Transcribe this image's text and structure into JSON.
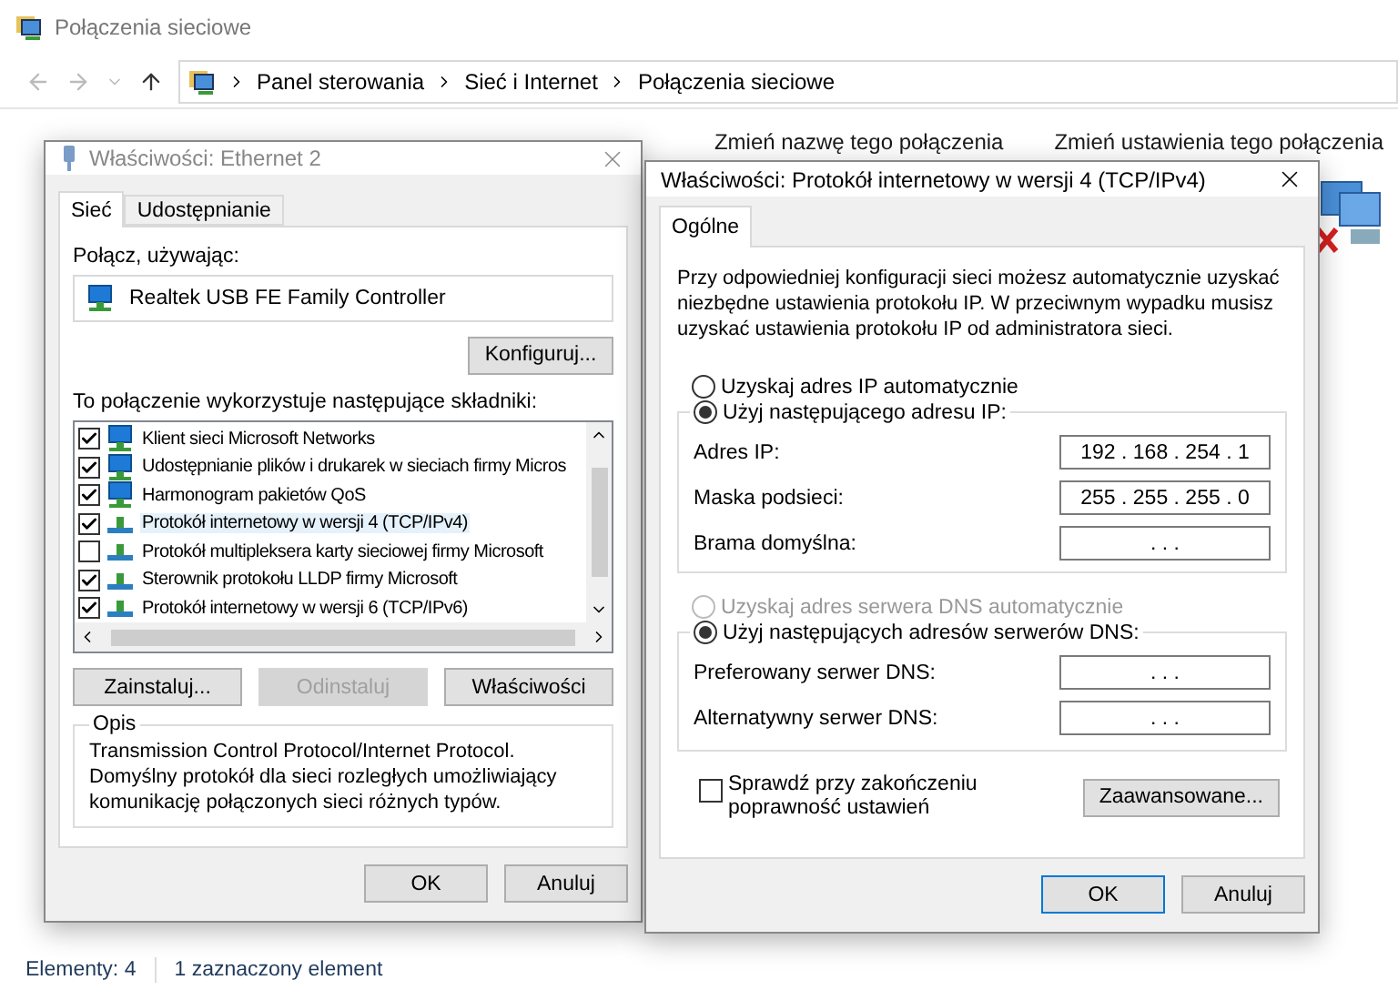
{
  "window": {
    "title": "Połączenia sieciowe"
  },
  "breadcrumb": [
    "Panel sterowania",
    "Sieć i Internet",
    "Połączenia sieciowe"
  ],
  "toolbar": [
    "Zmień nazwę tego połączenia",
    "Zmień ustawienia tego połączenia"
  ],
  "status_bar": {
    "items": "Elementy: 4",
    "selection": "1 zaznaczony element"
  },
  "ethernet_dialog": {
    "title": "Właściwości: Ethernet 2",
    "tabs": [
      {
        "label": "Sieć",
        "selected": true
      },
      {
        "label": "Udostępnianie",
        "selected": false
      }
    ],
    "connect_label": "Połącz, używając:",
    "adapter": "Realtek USB FE Family Controller",
    "configure_button": "Konfiguruj...",
    "components_label": "To połączenie wykorzystuje następujące składniki:",
    "components": [
      {
        "label": "Klient sieci Microsoft Networks",
        "checked": true,
        "selected": false,
        "kind": "service"
      },
      {
        "label": "Udostępnianie plików i drukarek w sieciach firmy Micros",
        "checked": true,
        "selected": false,
        "kind": "service"
      },
      {
        "label": "Harmonogram pakietów QoS",
        "checked": true,
        "selected": false,
        "kind": "service"
      },
      {
        "label": "Protokół internetowy w wersji 4 (TCP/IPv4)",
        "checked": true,
        "selected": true,
        "kind": "protocol"
      },
      {
        "label": "Protokół multipleksera karty sieciowej firmy Microsoft",
        "checked": false,
        "selected": false,
        "kind": "protocol"
      },
      {
        "label": "Sterownik protokołu LLDP firmy Microsoft",
        "checked": true,
        "selected": false,
        "kind": "protocol"
      },
      {
        "label": "Protokół internetowy w wersji 6 (TCP/IPv6)",
        "checked": true,
        "selected": false,
        "kind": "protocol"
      }
    ],
    "buttons": [
      {
        "label": "Zainstaluj...",
        "disabled": false
      },
      {
        "label": "Odinstaluj",
        "disabled": true
      },
      {
        "label": "Właściwości",
        "disabled": false
      }
    ],
    "description": {
      "title": "Opis",
      "text": "Transmission Control Protocol/Internet Protocol. Domyślny protokół dla sieci rozległych umożliwiający komunikację połączonych sieci różnych typów."
    },
    "footer_buttons": [
      "OK",
      "Anuluj"
    ]
  },
  "ipv4_dialog": {
    "title": "Właściwości: Protokół internetowy w wersji 4 (TCP/IPv4)",
    "tabs": [
      {
        "label": "Ogólne",
        "selected": true
      }
    ],
    "intro": "Przy odpowiedniej konfiguracji sieci możesz automatycznie uzyskać niezbędne ustawienia protokołu IP. W przeciwnym wypadku musisz uzyskać ustawienia protokołu IP od administratora sieci.",
    "ip_options": [
      {
        "label": "Uzyskaj adres IP automatycznie",
        "selected": false,
        "disabled": false
      },
      {
        "label": "Użyj następującego adresu IP:",
        "selected": true,
        "disabled": false
      }
    ],
    "ip_fields": [
      {
        "label": "Adres IP:",
        "value": "192 . 168 . 254 . 1"
      },
      {
        "label": "Maska podsieci:",
        "value": "255 . 255 . 255 . 0"
      },
      {
        "label": "Brama domyślna:",
        "value": ". . ."
      }
    ],
    "dns_options": [
      {
        "label": "Uzyskaj adres serwera DNS automatycznie",
        "selected": false,
        "disabled": true
      },
      {
        "label": "Użyj następujących adresów serwerów DNS:",
        "selected": true,
        "disabled": false
      }
    ],
    "dns_fields": [
      {
        "label": "Preferowany serwer DNS:",
        "value": ". . ."
      },
      {
        "label": "Alternatywny serwer DNS:",
        "value": ". . ."
      }
    ],
    "validate": {
      "label": "Sprawdź przy zakończeniu poprawność ustawień",
      "checked": false
    },
    "advanced_button": "Zaawansowane...",
    "footer_buttons": [
      "OK",
      "Anuluj"
    ]
  }
}
